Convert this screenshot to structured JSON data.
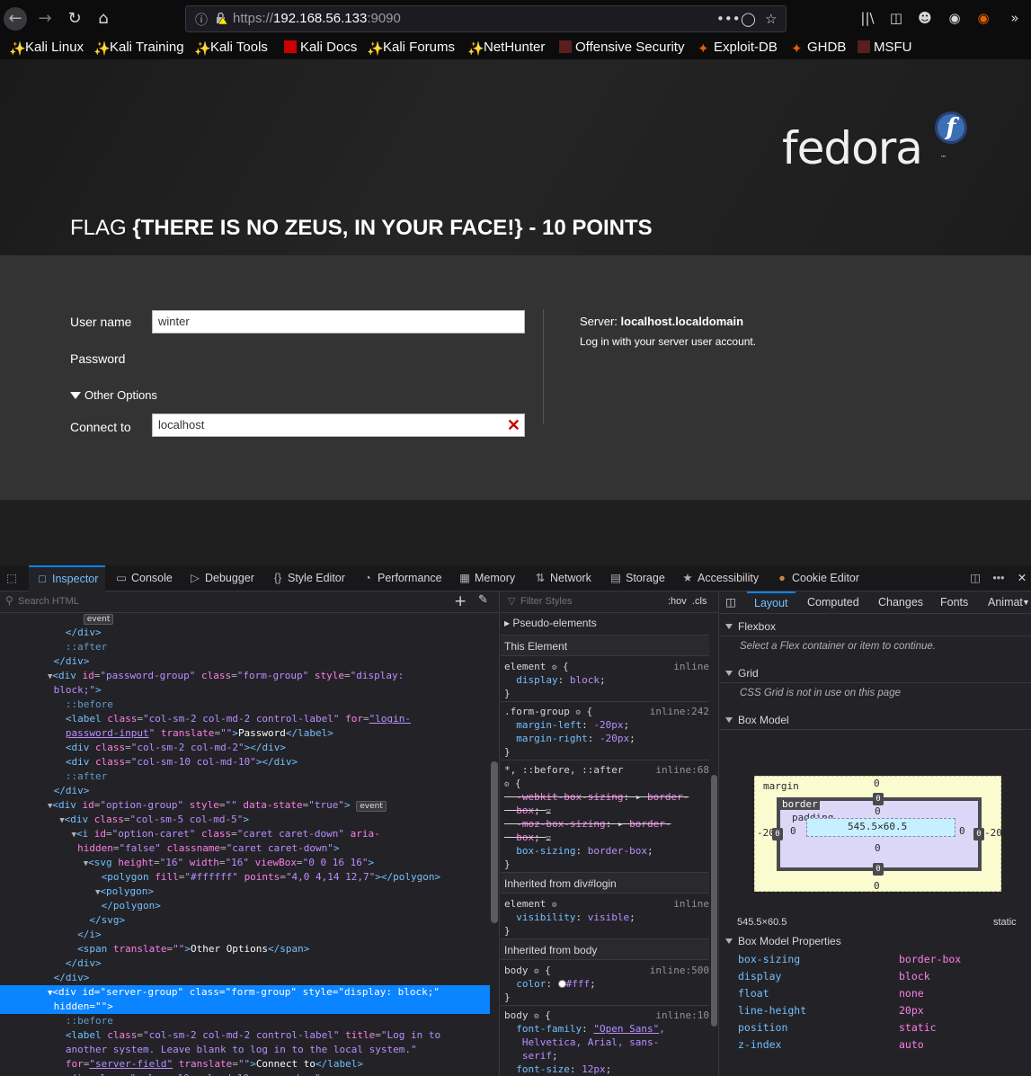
{
  "browser": {
    "url_host": "192.168.56.133",
    "url_prefix": "https://",
    "url_suffix": ":9090",
    "bookmarks": [
      "Kali Linux",
      "Kali Training",
      "Kali Tools",
      "Kali Docs",
      "Kali Forums",
      "NetHunter",
      "Offensive Security",
      "Exploit-DB",
      "GHDB",
      "MSFU"
    ]
  },
  "page": {
    "logo_text": "fedora",
    "flag_prefix": "FLAG ",
    "flag_bold": "{THERE IS NO ZEUS, IN YOUR FACE!} - 10 POINTS",
    "username_label": "User name",
    "username_value": "winter",
    "password_label": "Password",
    "other_options": "Other Options",
    "connect_label": "Connect to",
    "connect_value": "localhost",
    "server_label": "Server: ",
    "server_name": "localhost.localdomain",
    "server_hint": "Log in with your server user account."
  },
  "devtools": {
    "tabs": [
      "Inspector",
      "Console",
      "Debugger",
      "Style Editor",
      "Performance",
      "Memory",
      "Network",
      "Storage",
      "Accessibility",
      "Cookie Editor"
    ],
    "search_html_placeholder": "Search HTML",
    "filter_styles_placeholder": "Filter Styles",
    "hov": ":hov",
    "cls": ".cls",
    "rules": {
      "pseudo_elements": "Pseudo-elements",
      "this_element": "This Element",
      "inherited_login": "Inherited from div#login",
      "inherited_body": "Inherited from body"
    },
    "layout_tabs": [
      "Layout",
      "Computed",
      "Changes",
      "Fonts",
      "Animat"
    ],
    "flexbox_title": "Flexbox",
    "flexbox_note": "Select a Flex container or item to continue.",
    "grid_title": "Grid",
    "grid_note": "CSS Grid is not in use on this page",
    "boxmodel_title": "Box Model",
    "boxmodel_size": "545.5×60.5",
    "boxmodel_position": "static",
    "boxmodel_labels": {
      "margin": "margin",
      "border": "border",
      "padding": "padding"
    },
    "boxmodel_props_title": "Box Model Properties",
    "boxmodel_props": [
      {
        "k": "box-sizing",
        "v": "border-box"
      },
      {
        "k": "display",
        "v": "block"
      },
      {
        "k": "float",
        "v": "none"
      },
      {
        "k": "line-height",
        "v": "20px"
      },
      {
        "k": "position",
        "v": "static"
      },
      {
        "k": "z-index",
        "v": "auto"
      }
    ]
  }
}
